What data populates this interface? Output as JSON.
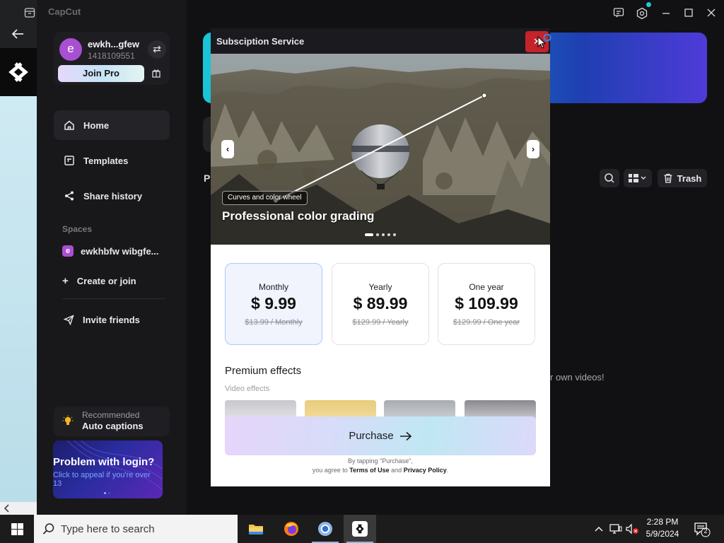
{
  "app": {
    "name": "CapCut"
  },
  "user": {
    "avatar_letter": "e",
    "name": "ewkh...gfew",
    "id": "1418109551",
    "join_pro": "Join Pro"
  },
  "sidebar": {
    "items": [
      {
        "label": "Home",
        "icon": "home-icon"
      },
      {
        "label": "Templates",
        "icon": "templates-icon"
      },
      {
        "label": "Share history",
        "icon": "share-icon"
      }
    ],
    "spaces_label": "Spaces",
    "space": {
      "badge": "e",
      "name": "ewkhbfw wibgfe..."
    },
    "create_join": "Create or join",
    "invite": "Invite friends",
    "recommended": {
      "label": "Recommended",
      "title": "Auto captions"
    },
    "login_banner": {
      "title": "Problem with login?",
      "subtitle": "Click to appeal if you're over 13"
    }
  },
  "main": {
    "section_letter": "P",
    "trash": "Trash",
    "empty_text": "r own videos!"
  },
  "modal": {
    "title": "Subsciption Service",
    "close": "✕",
    "hero": {
      "tag": "Curves and color wheel",
      "title": "Professional color grading",
      "slides": 5,
      "active_slide": 0
    },
    "plans": [
      {
        "name": "Monthly",
        "price": "$ 9.99",
        "original": "$13.99 / Monthly",
        "selected": true
      },
      {
        "name": "Yearly",
        "price": "$ 89.99",
        "original": "$129.99 / Yearly",
        "selected": false
      },
      {
        "name": "One year",
        "price": "$ 109.99",
        "original": "$129.99 / One year",
        "selected": false
      }
    ],
    "premium_title": "Premium effects",
    "premium_sub": "Video effects",
    "purchase": "Purchase",
    "terms_line1": "By tapping \"Purchase\",",
    "terms_prefix": "you agree to ",
    "terms_of_use": "Terms of Use",
    "terms_and": " and ",
    "privacy_policy": "Privacy Policy",
    "terms_suffix": "."
  },
  "taskbar": {
    "search_placeholder": "Type here to search",
    "time": "2:28 PM",
    "date": "5/9/2024",
    "notification_count": "2"
  }
}
